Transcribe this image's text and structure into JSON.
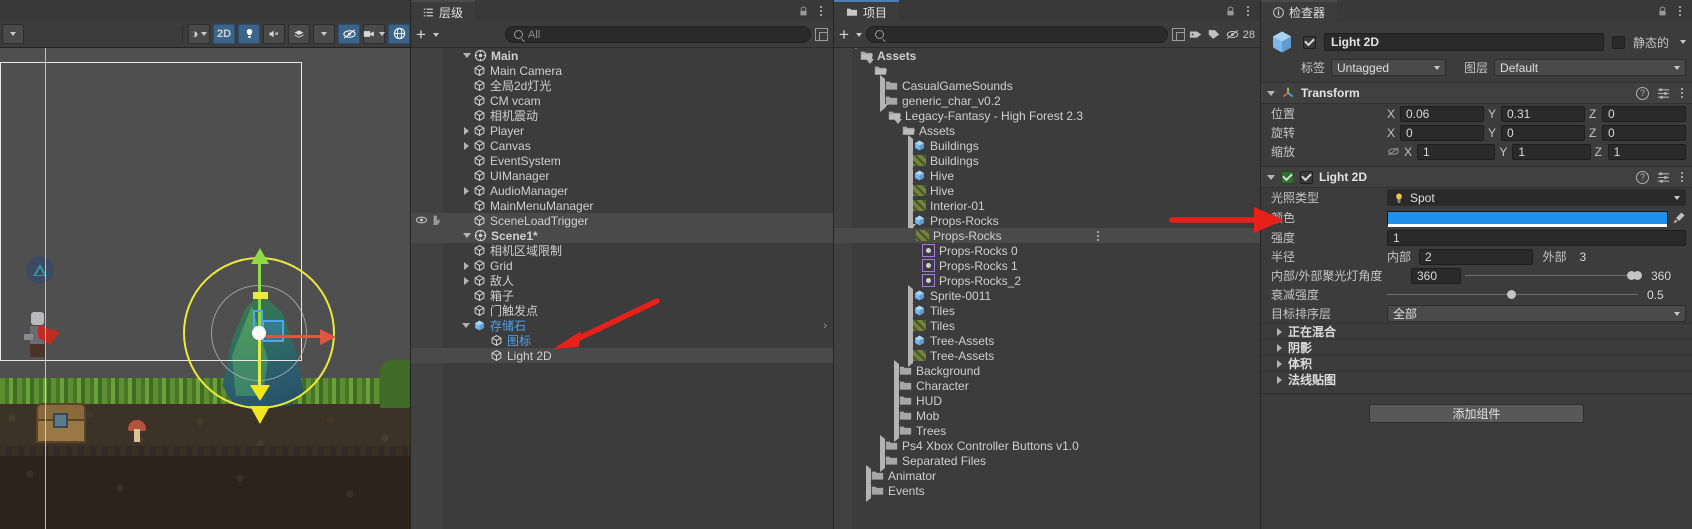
{
  "scene_toolbar": {
    "buttons": [
      {
        "name": "hand-tool-dropdown",
        "label": "▾"
      },
      {
        "name": "shading-mode",
        "label": "◑"
      },
      {
        "name": "toggle-2d",
        "label": "2D"
      },
      {
        "name": "toggle-lighting",
        "label": "💡"
      },
      {
        "name": "toggle-audio",
        "label": "♪"
      },
      {
        "name": "fx-dropdown",
        "label": "✨"
      },
      {
        "name": "hidden-objects",
        "label": "⊘"
      },
      {
        "name": "camera-settings",
        "label": "▬"
      },
      {
        "name": "gizmos-toggle",
        "label": "◎"
      },
      {
        "name": "scene-kebab",
        "label": "⋮"
      }
    ]
  },
  "hierarchy": {
    "tab_label": "层级",
    "add_label": "+",
    "search_placeholder": "All",
    "items": [
      {
        "indent": 0,
        "twisty": "down",
        "icon": "scene-icon",
        "label": "Main",
        "bold": true,
        "selected": false
      },
      {
        "indent": 1,
        "twisty": "none",
        "icon": "gameobject-icon",
        "label": "Main Camera",
        "bold": false,
        "selected": false
      },
      {
        "indent": 1,
        "twisty": "none",
        "icon": "gameobject-icon",
        "label": "全局2d灯光",
        "bold": false,
        "selected": false
      },
      {
        "indent": 1,
        "twisty": "none",
        "icon": "gameobject-icon",
        "label": "CM vcam",
        "bold": false,
        "selected": false
      },
      {
        "indent": 1,
        "twisty": "none",
        "icon": "gameobject-icon",
        "label": "相机震动",
        "bold": false,
        "selected": false
      },
      {
        "indent": 1,
        "twisty": "right",
        "icon": "gameobject-icon",
        "label": "Player",
        "bold": false,
        "selected": false
      },
      {
        "indent": 1,
        "twisty": "right",
        "icon": "gameobject-icon",
        "label": "Canvas",
        "bold": false,
        "selected": false
      },
      {
        "indent": 1,
        "twisty": "none",
        "icon": "gameobject-icon",
        "label": "EventSystem",
        "bold": false,
        "selected": false
      },
      {
        "indent": 1,
        "twisty": "none",
        "icon": "gameobject-icon",
        "label": "UIManager",
        "bold": false,
        "selected": false
      },
      {
        "indent": 1,
        "twisty": "right",
        "icon": "gameobject-icon",
        "label": "AudioManager",
        "bold": false,
        "selected": false
      },
      {
        "indent": 1,
        "twisty": "none",
        "icon": "gameobject-icon",
        "label": "MainMenuManager",
        "bold": false,
        "selected": false
      },
      {
        "indent": 1,
        "twisty": "none",
        "icon": "gameobject-icon",
        "label": "SceneLoadTrigger",
        "bold": false,
        "selected": false,
        "hover": true
      },
      {
        "indent": 0,
        "twisty": "down",
        "icon": "scene-icon",
        "label": "Scene1*",
        "bold": true,
        "selected": false,
        "row_highlight": true
      },
      {
        "indent": 1,
        "twisty": "none",
        "icon": "gameobject-icon",
        "label": "相机区域限制",
        "bold": false,
        "selected": false
      },
      {
        "indent": 1,
        "twisty": "right",
        "icon": "gameobject-icon",
        "label": "Grid",
        "bold": false,
        "selected": false
      },
      {
        "indent": 1,
        "twisty": "right",
        "icon": "gameobject-icon",
        "label": "敌人",
        "bold": false,
        "selected": false
      },
      {
        "indent": 1,
        "twisty": "none",
        "icon": "gameobject-icon",
        "label": "箱子",
        "bold": false,
        "selected": false
      },
      {
        "indent": 1,
        "twisty": "none",
        "icon": "gameobject-icon",
        "label": "门触发点",
        "bold": false,
        "selected": false
      },
      {
        "indent": 1,
        "twisty": "down",
        "icon": "prefab-icon",
        "label": "存储石",
        "bold": false,
        "blue": true,
        "has_arrow": true
      },
      {
        "indent": 2,
        "twisty": "none",
        "icon": "gameobject-icon",
        "label": "图标",
        "bold": false,
        "blue": true
      },
      {
        "indent": 2,
        "twisty": "none",
        "icon": "gameobject-icon",
        "label": "Light 2D",
        "bold": false,
        "selected": true
      }
    ]
  },
  "project": {
    "tab_label": "项目",
    "add_label": "+",
    "search_placeholder": "",
    "hidden_count": "28",
    "items": [
      {
        "indent": 0,
        "twisty": "down",
        "icon": "folder-open-icon",
        "label": "Assets",
        "bold": true
      },
      {
        "indent": 1,
        "twisty": "down",
        "icon": "folder-open-icon",
        "label": ""
      },
      {
        "indent": 2,
        "twisty": "right",
        "icon": "folder-icon",
        "label": "CasualGameSounds"
      },
      {
        "indent": 2,
        "twisty": "right",
        "icon": "folder-icon",
        "label": "generic_char_v0.2"
      },
      {
        "indent": 2,
        "twisty": "down",
        "icon": "folder-open-icon",
        "label": "Legacy-Fantasy - High Forest 2.3"
      },
      {
        "indent": 3,
        "twisty": "down",
        "icon": "folder-open-icon",
        "label": "Assets"
      },
      {
        "indent": 4,
        "twisty": "right",
        "icon": "prefab-icon",
        "label": "Buildings"
      },
      {
        "indent": 4,
        "twisty": "right",
        "icon": "sprite-sheet-icon",
        "label": "Buildings"
      },
      {
        "indent": 4,
        "twisty": "right",
        "icon": "prefab-icon",
        "label": "Hive"
      },
      {
        "indent": 4,
        "twisty": "right",
        "icon": "sprite-sheet-icon",
        "label": "Hive"
      },
      {
        "indent": 4,
        "twisty": "right",
        "icon": "sprite-sheet-icon",
        "label": "Interior-01"
      },
      {
        "indent": 4,
        "twisty": "right",
        "icon": "prefab-icon",
        "label": "Props-Rocks"
      },
      {
        "indent": 4,
        "twisty": "down",
        "icon": "sprite-sheet-icon",
        "label": "Props-Rocks",
        "row_highlight": true
      },
      {
        "indent": 5,
        "twisty": "none",
        "icon": "sprite-icon",
        "label": "Props-Rocks 0"
      },
      {
        "indent": 5,
        "twisty": "none",
        "icon": "sprite-icon",
        "label": "Props-Rocks 1"
      },
      {
        "indent": 5,
        "twisty": "none",
        "icon": "sprite-icon",
        "label": "Props-Rocks_2"
      },
      {
        "indent": 4,
        "twisty": "right",
        "icon": "prefab-icon",
        "label": "Sprite-0011"
      },
      {
        "indent": 4,
        "twisty": "right",
        "icon": "prefab-icon",
        "label": "Tiles"
      },
      {
        "indent": 4,
        "twisty": "right",
        "icon": "sprite-sheet-icon",
        "label": "Tiles"
      },
      {
        "indent": 4,
        "twisty": "right",
        "icon": "prefab-icon",
        "label": "Tree-Assets"
      },
      {
        "indent": 4,
        "twisty": "right",
        "icon": "sprite-sheet-icon",
        "label": "Tree-Assets"
      },
      {
        "indent": 3,
        "twisty": "right",
        "icon": "folder-icon",
        "label": "Background"
      },
      {
        "indent": 3,
        "twisty": "right",
        "icon": "folder-icon",
        "label": "Character"
      },
      {
        "indent": 3,
        "twisty": "right",
        "icon": "folder-icon",
        "label": "HUD"
      },
      {
        "indent": 3,
        "twisty": "right",
        "icon": "folder-icon",
        "label": "Mob"
      },
      {
        "indent": 3,
        "twisty": "right",
        "icon": "folder-icon",
        "label": "Trees"
      },
      {
        "indent": 2,
        "twisty": "right",
        "icon": "folder-icon",
        "label": "Ps4 Xbox Controller Buttons v1.0"
      },
      {
        "indent": 2,
        "twisty": "right",
        "icon": "folder-icon",
        "label": "Separated Files"
      },
      {
        "indent": 1,
        "twisty": "right",
        "icon": "folder-icon",
        "label": "Animator"
      },
      {
        "indent": 1,
        "twisty": "right",
        "icon": "folder-icon",
        "label": "Events"
      }
    ]
  },
  "inspector": {
    "tab_label": "检查器",
    "object_name": "Light 2D",
    "static_label": "静态的",
    "tag_label": "标签",
    "tag_value": "Untagged",
    "layer_label": "图层",
    "layer_value": "Default",
    "transform": {
      "title": "Transform",
      "position_label": "位置",
      "rotation_label": "旋转",
      "scale_label": "缩放",
      "position": {
        "x": "0.06",
        "y": "0.31",
        "z": "0"
      },
      "rotation": {
        "x": "0",
        "y": "0",
        "z": "0"
      },
      "scale": {
        "x": "1",
        "y": "1",
        "z": "1"
      }
    },
    "light2d": {
      "title": "Light 2D",
      "light_type_label": "光照类型",
      "light_type_value": "Spot",
      "color_label": "颜色",
      "color_value": "#1f8fea",
      "intensity_label": "强度",
      "intensity_value": "1",
      "radius_label": "半径",
      "inner_label": "内部",
      "inner_value": "2",
      "outer_label": "外部",
      "outer_value": "3",
      "spot_angle_label": "内部/外部聚光灯角度",
      "spot_angle_inner": "360",
      "spot_angle_outer": "360",
      "falloff_label": "衰减强度",
      "falloff_value": "0.5",
      "sorting_label": "目标排序层",
      "sorting_value": "全部",
      "sections": [
        "正在混合",
        "阴影",
        "体积",
        "法线贴图"
      ]
    },
    "add_component_label": "添加组件"
  }
}
